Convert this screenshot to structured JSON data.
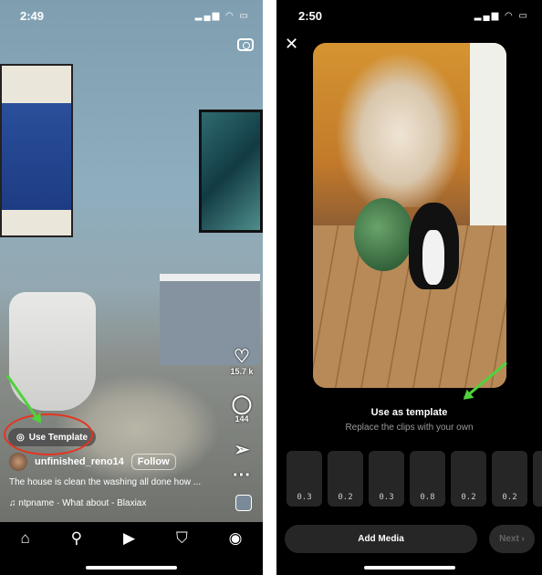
{
  "left": {
    "time": "2:49",
    "status_icons": "▂▄▆ ◠ ▭",
    "likes": "15.7 k",
    "comments": "144",
    "use_template": "Use Template",
    "username": "unfinished_reno14",
    "follow": "Follow",
    "caption": "The house is clean the washing all done how ...",
    "music": "ntpname · What about - Blaxiax",
    "nav": [
      "home-icon",
      "search-icon",
      "reels-icon",
      "shop-icon",
      "profile-icon"
    ]
  },
  "right": {
    "time": "2:50",
    "status_icons": "▂▄▆ ◠ ▭",
    "title": "Use as template",
    "subtitle": "Replace the clips with your own",
    "clips": [
      "0.3",
      "0.2",
      "0.3",
      "0.8",
      "0.2",
      "0.2"
    ],
    "add_media": "Add Media",
    "next": "Next"
  },
  "colors": {
    "annotation_arrow": "#4fd23c",
    "annotation_oval": "#e6331f"
  }
}
